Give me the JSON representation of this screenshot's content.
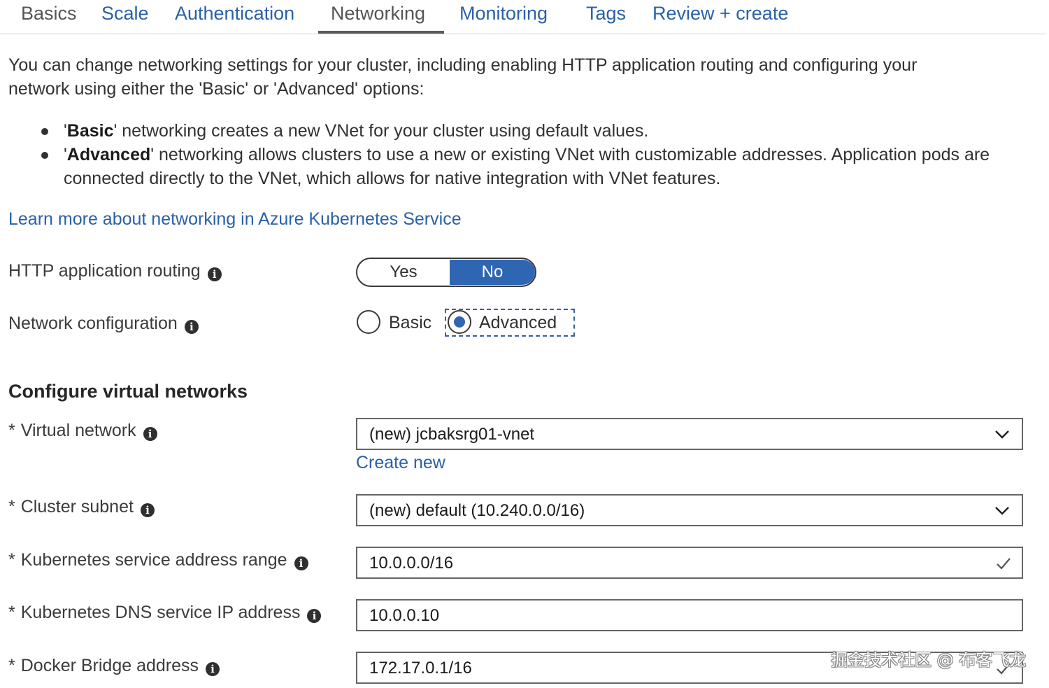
{
  "tabs": [
    {
      "label": "Basics"
    },
    {
      "label": "Scale"
    },
    {
      "label": "Authentication"
    },
    {
      "label": "Networking"
    },
    {
      "label": "Monitoring"
    },
    {
      "label": "Tags"
    },
    {
      "label": "Review + create"
    }
  ],
  "active_tab": "Networking",
  "intro": {
    "line1": "You can change networking settings for your cluster, including enabling HTTP application routing and configuring your",
    "line2": "network using either the 'Basic' or 'Advanced' options:"
  },
  "bullets": [
    {
      "open": "'",
      "bold": "Basic",
      "rest": "' networking creates a new VNet for your cluster using default values."
    },
    {
      "open": "'",
      "bold": "Advanced",
      "rest": "' networking allows clusters to use a new or existing VNet with customizable addresses. Application pods are connected directly to the VNet, which allows for native integration with VNet features."
    }
  ],
  "learn_more_link": "Learn more about networking in Azure Kubernetes Service",
  "http_routing": {
    "label": "HTTP application routing",
    "yes_label": "Yes",
    "no_label": "No",
    "selected": "No"
  },
  "network_config": {
    "label": "Network configuration",
    "options": [
      "Basic",
      "Advanced"
    ],
    "selected": "Advanced"
  },
  "section_title": "Configure virtual networks",
  "required_mark": "*",
  "virtual_network": {
    "label": "Virtual network",
    "value": "(new) jcbaksrg01-vnet",
    "create_new": "Create new"
  },
  "cluster_subnet": {
    "label": "Cluster subnet",
    "value": "(new) default (10.240.0.0/16)"
  },
  "service_address_range": {
    "label": "Kubernetes service address range",
    "value": "10.0.0.0/16"
  },
  "dns_service_ip": {
    "label": "Kubernetes DNS service IP address",
    "value": "10.0.0.10"
  },
  "docker_bridge": {
    "label": "Docker Bridge address",
    "value": "172.17.0.1/16"
  },
  "info_glyph": "i",
  "watermark": "掘金技术社区 @ 布客飞龙",
  "colors": {
    "link": "#2a61a8",
    "accent": "#2f66b3",
    "text": "#323130",
    "border": "#666666"
  }
}
